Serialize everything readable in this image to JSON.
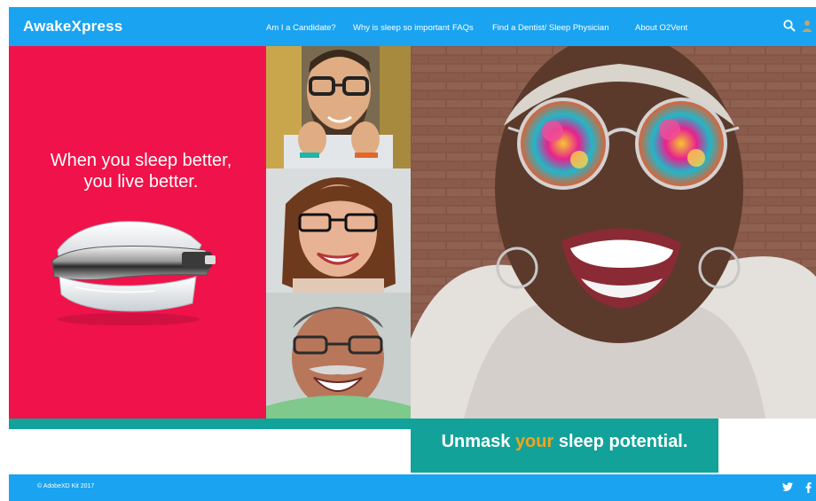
{
  "header": {
    "brand": "AwakeXpress",
    "nav": [
      {
        "label": "Am I a Candidate?"
      },
      {
        "label": "Why is sleep so important"
      },
      {
        "label": "FAQs"
      },
      {
        "label": "Find a Dentist/ Sleep Physician"
      },
      {
        "label": "About O2Vent"
      }
    ],
    "icons": [
      "search-icon",
      "user-icon"
    ]
  },
  "hero": {
    "tagline_line1": "When you sleep better,",
    "tagline_line2": "you live better."
  },
  "headline": {
    "before": "Unmask ",
    "accent": "your",
    "after": " sleep potential."
  },
  "footer": {
    "copyright": "© AdobeXD Kit 2017",
    "social": [
      "twitter-icon",
      "facebook-icon"
    ]
  },
  "colors": {
    "header_blue": "#1aa3f0",
    "hero_red": "#f0124a",
    "teal": "#12a29a",
    "accent_orange": "#f7a21c"
  }
}
